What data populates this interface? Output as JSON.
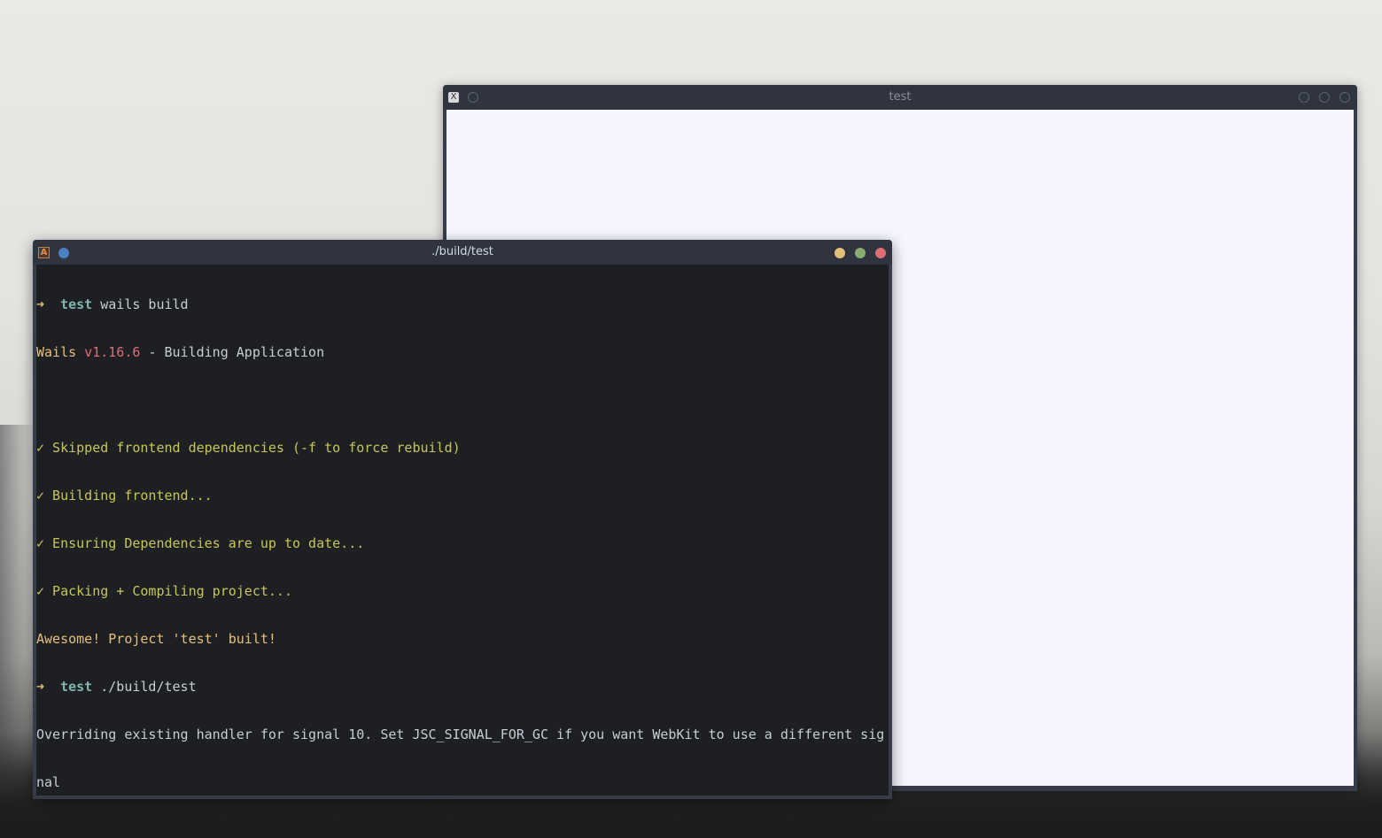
{
  "background_window": {
    "title": "test",
    "app_icon_glyph": "X"
  },
  "terminal_window": {
    "title": "./build/test",
    "app_icon_glyph": "A",
    "lines": {
      "l1_arrow": "➜",
      "l1_dir": "test",
      "l1_cmd": " wails build",
      "l2_wails": "Wails",
      "l2_ver": " v1.16.6",
      "l2_rest": " - Building Application",
      "l4": "✓ Skipped frontend dependencies (-f to force rebuild)",
      "l5": "✓ Building frontend...",
      "l6": "✓ Ensuring Dependencies are up to date...",
      "l7": "✓ Packing + Compiling project...",
      "l8": "Awesome! Project 'test' built!",
      "l9_arrow": "➜",
      "l9_dir": "test",
      "l9_cmd": " ./build/test",
      "l10": "Overriding existing handler for signal 10. Set JSC_SIGNAL_FOR_GC if you want WebKit to use a different sig",
      "l11": "nal"
    }
  },
  "colors": {
    "titlebar": "#2f343f",
    "terminal_bg": "#1e1f22",
    "webview_bg": "#f5f5fd",
    "prompt_arrow": "#e5c07b",
    "prompt_dir": "#7fb6b2",
    "check_green": "#c5c75a",
    "version_red": "#e06c75",
    "close": "#e06c75",
    "minimize": "#e5c07b",
    "maximize": "#98c379"
  }
}
